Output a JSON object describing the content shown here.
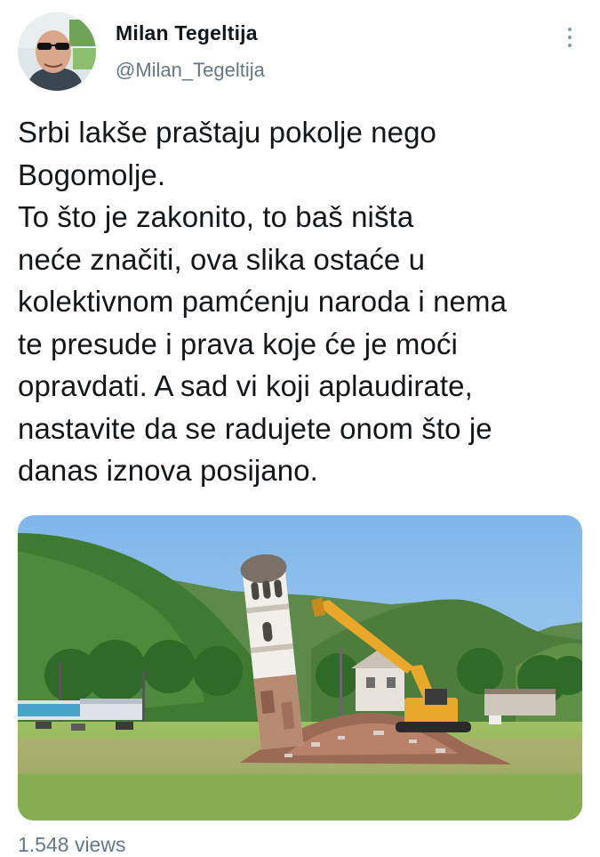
{
  "tweet": {
    "author": {
      "display_name": "Milan Tegeltija",
      "handle": "@Milan_Tegeltija",
      "avatar": "avatar-photo"
    },
    "menu_icon": "more-vertical-icon",
    "text": "Srbi lakše praštaju pokolje nego\nBogomolje.\nTo što je zakonito, to baš ništa\nneće značiti, ova slika ostaće u\nkolektivnom pamćenju naroda i nema\nte presude i prava koje će je moći\nopravdati. A sad vi koji aplaudirate,\nnastavite da se radujete onom što je\ndanas iznova posijano.",
    "media": {
      "type": "photo",
      "alt": ""
    },
    "views": "1.548 views"
  },
  "colors": {
    "text": "#14171a",
    "secondary_text": "#657786",
    "icon": "#8899a6"
  }
}
